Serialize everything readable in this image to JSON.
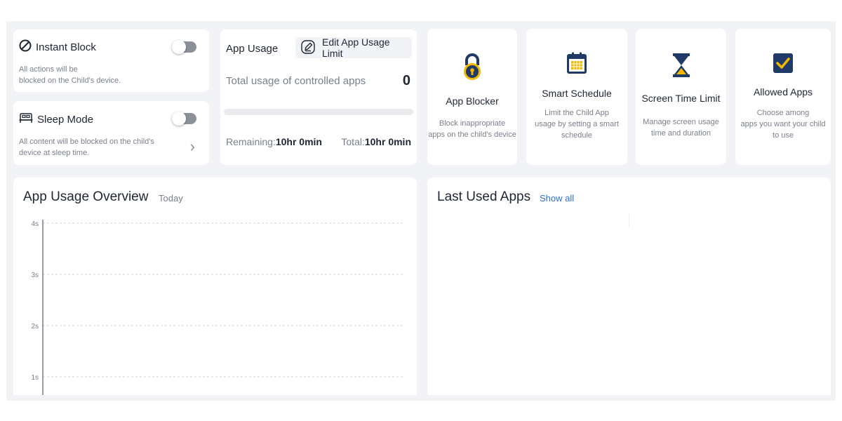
{
  "instant_block": {
    "title": "Instant Block",
    "description_line1": "All actions will be",
    "description_line2": "blocked on the Child's device.",
    "toggle_on": false
  },
  "sleep_mode": {
    "title": "Sleep Mode",
    "description_line1": "All content will be blocked on the child's",
    "description_line2": "device at sleep time.",
    "toggle_on": false
  },
  "app_usage": {
    "title": "App Usage",
    "edit_label": "Edit App Usage Limit",
    "total_label": "Total usage of controlled apps",
    "total_count": "0",
    "progress": 0,
    "remaining_label": "Remaining:",
    "remaining_value": "10hr 0min",
    "total_time_label": "Total:",
    "total_time_value": "10hr 0min"
  },
  "features": [
    {
      "icon": "lock-icon",
      "title": "App Blocker",
      "desc_line1": "Block inappropriate",
      "desc_line2": "apps on the child's device",
      "desc_line3": ""
    },
    {
      "icon": "calendar-icon",
      "title": "Smart Schedule",
      "desc_line1": "Limit the Child App",
      "desc_line2": "usage by setting a smart",
      "desc_line3": "schedule"
    },
    {
      "icon": "hourglass-icon",
      "title": "Screen Time Limit",
      "desc_line1": "Manage screen usage",
      "desc_line2": "time and duration",
      "desc_line3": ""
    },
    {
      "icon": "checkbox-icon",
      "title": "Allowed Apps",
      "desc_line1": "Choose among",
      "desc_line2": "apps you want your child",
      "desc_line3": "to use"
    }
  ],
  "overview": {
    "title": "App Usage Overview",
    "period": "Today"
  },
  "last_used": {
    "title": "Last Used Apps",
    "show_all": "Show all"
  },
  "colors": {
    "accent": "#1f3a66",
    "icon_yellow": "#f5b800",
    "link": "#2f6fd6",
    "background": "#f1f3f6"
  },
  "chart_data": {
    "type": "bar",
    "title": "",
    "y_ticks": [
      "4s",
      "3s",
      "2s",
      "1s"
    ],
    "ylim": [
      1,
      4
    ],
    "categories": [],
    "values": [],
    "grid": true
  }
}
